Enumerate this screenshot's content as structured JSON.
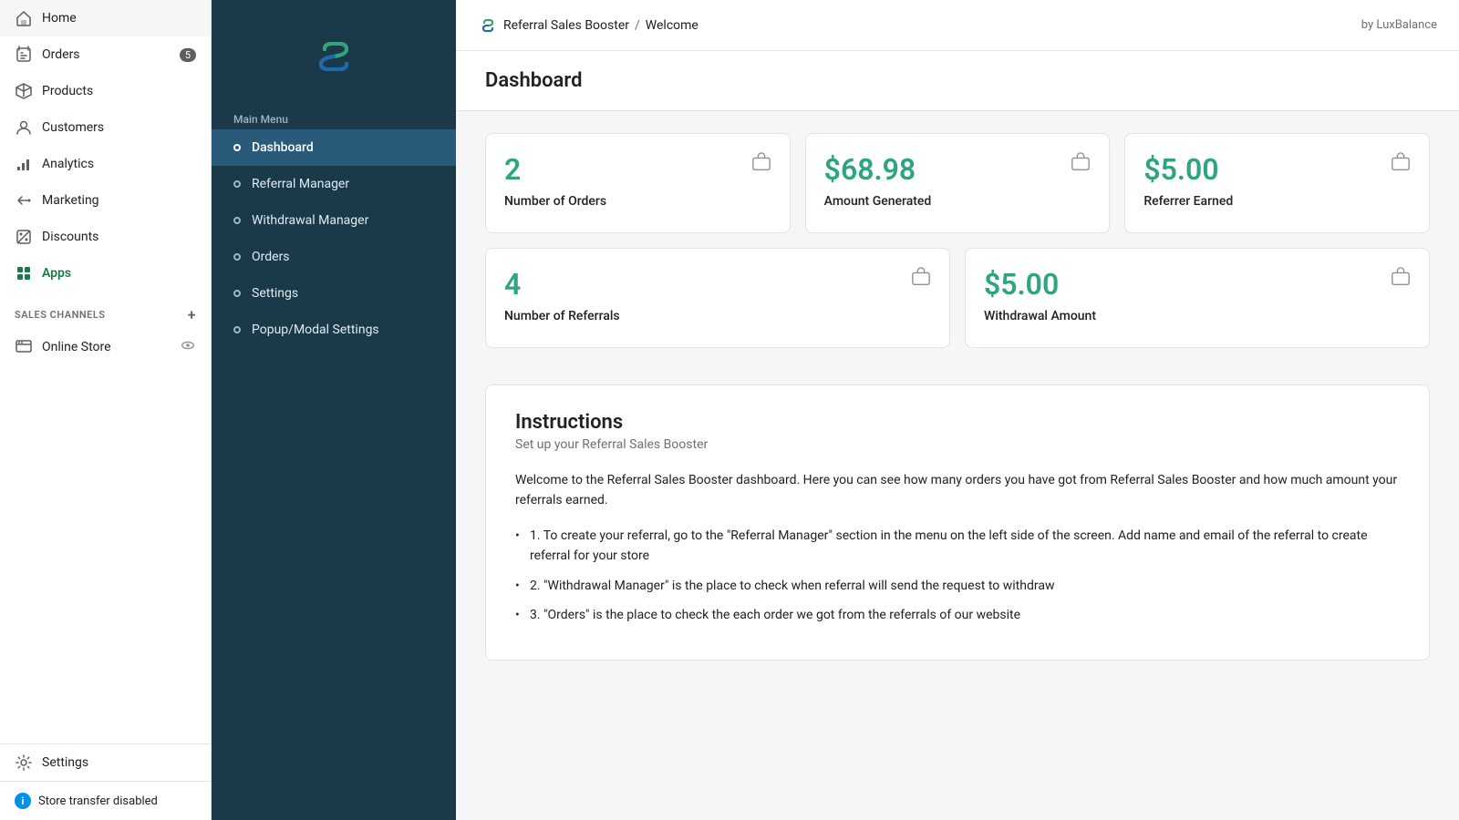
{
  "shopify_sidebar": {
    "nav_items": [
      {
        "id": "home",
        "label": "Home",
        "icon": "home-icon",
        "badge": null
      },
      {
        "id": "orders",
        "label": "Orders",
        "icon": "orders-icon",
        "badge": "5"
      },
      {
        "id": "products",
        "label": "Products",
        "icon": "products-icon",
        "badge": null
      },
      {
        "id": "customers",
        "label": "Customers",
        "icon": "customers-icon",
        "badge": null
      },
      {
        "id": "analytics",
        "label": "Analytics",
        "icon": "analytics-icon",
        "badge": null
      },
      {
        "id": "marketing",
        "label": "Marketing",
        "icon": "marketing-icon",
        "badge": null
      },
      {
        "id": "discounts",
        "label": "Discounts",
        "icon": "discounts-icon",
        "badge": null
      },
      {
        "id": "apps",
        "label": "Apps",
        "icon": "apps-icon",
        "badge": null
      }
    ],
    "sales_channels_label": "SALES CHANNELS",
    "online_store_label": "Online Store",
    "settings_label": "Settings",
    "store_transfer_label": "Store transfer disabled"
  },
  "app_sidebar": {
    "section_label": "Main Menu",
    "items": [
      {
        "id": "dashboard",
        "label": "Dashboard",
        "active": true
      },
      {
        "id": "referral-manager",
        "label": "Referral Manager",
        "active": false
      },
      {
        "id": "withdrawal-manager",
        "label": "Withdrawal Manager",
        "active": false
      },
      {
        "id": "orders",
        "label": "Orders",
        "active": false
      },
      {
        "id": "settings",
        "label": "Settings",
        "active": false
      },
      {
        "id": "popup-modal-settings",
        "label": "Popup/Modal Settings",
        "active": false
      }
    ]
  },
  "topbar": {
    "app_name": "Referral Sales Booster",
    "separator": "/",
    "page_name": "Welcome",
    "by_label": "by LuxBalance"
  },
  "dashboard": {
    "title": "Dashboard",
    "stats": [
      {
        "row": 1,
        "cards": [
          {
            "id": "num-orders",
            "value": "2",
            "label": "Number of Orders"
          },
          {
            "id": "amount-generated",
            "value": "$68.98",
            "label": "Amount Generated"
          },
          {
            "id": "referrer-earned",
            "value": "$5.00",
            "label": "Referrer Earned"
          }
        ]
      },
      {
        "row": 2,
        "cards": [
          {
            "id": "num-referrals",
            "value": "4",
            "label": "Number of Referrals"
          },
          {
            "id": "withdrawal-amount",
            "value": "$5.00",
            "label": "Withdrawal Amount"
          }
        ]
      }
    ],
    "instructions": {
      "title": "Instructions",
      "subtitle": "Set up your Referral Sales Booster",
      "intro": "Welcome to the Referral Sales Booster dashboard. Here you can see how many orders you have got from Referral Sales Booster and how much amount your referrals earned.",
      "steps": [
        "1. To create your referral, go to the \"Referral Manager\" section in the menu on the left side of the screen. Add name and email of the referral to create referral for your store",
        "2. \"Withdrawal Manager\" is the place to check when referral will send the request to withdraw",
        "3. \"Orders\" is the place to check the each order we got from the referrals of our website"
      ]
    }
  }
}
